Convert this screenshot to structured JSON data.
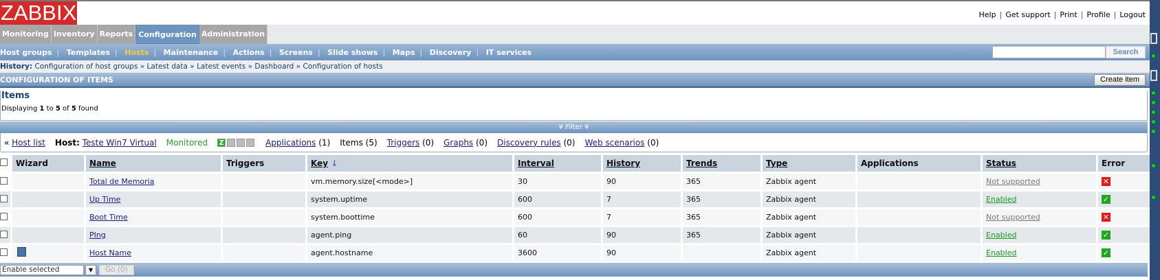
{
  "logo": "ZABBIX",
  "toplinks": [
    "Help",
    "Get support",
    "Print",
    "Profile",
    "Logout"
  ],
  "mainmenu": [
    "Monitoring",
    "Inventory",
    "Reports",
    "Configuration",
    "Administration"
  ],
  "submenu": [
    "Host groups",
    "Templates",
    "Hosts",
    "Maintenance",
    "Actions",
    "Screens",
    "Slide shows",
    "Maps",
    "Discovery",
    "IT services"
  ],
  "search": {
    "value": "",
    "button": "Search"
  },
  "history": {
    "label": "History:",
    "items": [
      "Configuration of host groups",
      "Latest data",
      "Latest events",
      "Dashboard",
      "Configuration of hosts"
    ]
  },
  "page_title": "CONFIGURATION OF ITEMS",
  "create_item": "Create item",
  "items_heading": "Items",
  "displaying": {
    "pre": "Displaying ",
    "from": "1",
    " to": " to ",
    "to_n": "5",
    "of": " of ",
    "total": "5",
    "post": " found"
  },
  "filter": "¥ Filter ¥",
  "hostbar": {
    "host_list": "Host list",
    "host_label": "Host:",
    "host": "Teste Win7 Virtual",
    "status": "Monitored",
    "z": "Z",
    "applications": "Applications",
    "applications_count": "(1)",
    "items": "Items (5)",
    "triggers": "Triggers",
    "triggers_count": "(0)",
    "graphs": "Graphs",
    "graphs_count": "(0)",
    "discovery": "Discovery rules",
    "discovery_count": "(0)",
    "web": "Web scenarios",
    "web_count": "(0)"
  },
  "columns": [
    "Wizard",
    "Name",
    "Triggers",
    "Key",
    "Interval",
    "History",
    "Trends",
    "Type",
    "Applications",
    "Status",
    "Error"
  ],
  "rows": [
    {
      "name": "Total de Memoria",
      "key": "vm.memory.size[<mode>]",
      "interval": "30",
      "history": "90",
      "trends": "365",
      "type": "Zabbix agent",
      "applications": "",
      "status": "Not supported",
      "error": "x",
      "wizard": false
    },
    {
      "name": "Up Time",
      "key": "system.uptime",
      "interval": "600",
      "history": "7",
      "trends": "365",
      "type": "Zabbix agent",
      "applications": "",
      "status": "Enabled",
      "error": "ok",
      "wizard": false
    },
    {
      "name": "Boot Time",
      "key": "system.boottime",
      "interval": "600",
      "history": "7",
      "trends": "365",
      "type": "Zabbix agent",
      "applications": "",
      "status": "Not supported",
      "error": "x",
      "wizard": false
    },
    {
      "name": "PIng",
      "key": "agent.ping",
      "interval": "60",
      "history": "90",
      "trends": "365",
      "type": "Zabbix agent",
      "applications": "",
      "status": "Enabled",
      "error": "ok",
      "wizard": false
    },
    {
      "name": "Host Name",
      "key": "agent.hostname",
      "interval": "3600",
      "history": "90",
      "trends": "",
      "type": "Zabbix agent",
      "applications": "",
      "status": "Enabled",
      "error": "ok",
      "wizard": true
    }
  ],
  "footer": {
    "action": "Enable selected",
    "go": "Go (0)"
  }
}
